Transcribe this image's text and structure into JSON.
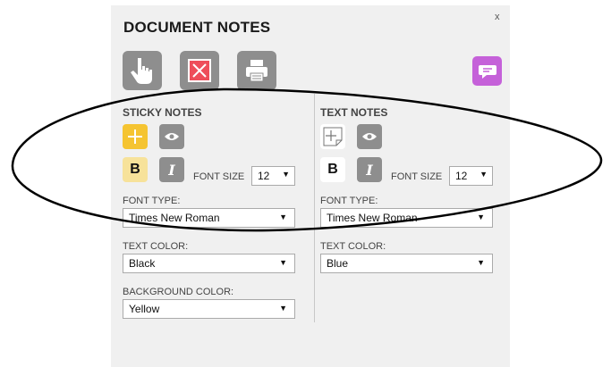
{
  "panel": {
    "title": "DOCUMENT NOTES",
    "close_label": "x"
  },
  "toolbar": {
    "select_icon": "hand-pointer-icon",
    "delete_icon": "delete-note-icon",
    "print_icon": "printer-icon",
    "comment_icon": "speech-bubble-icon"
  },
  "sticky": {
    "title": "STICKY NOTES",
    "bold_label": "B",
    "italic_label": "I",
    "font_size_label": "FONT SIZE",
    "font_size_value": "12",
    "font_type_label": "FONT TYPE:",
    "font_type_value": "Times New Roman",
    "text_color_label": "TEXT COLOR:",
    "text_color_value": "Black",
    "bg_color_label": "BACKGROUND COLOR:",
    "bg_color_value": "Yellow"
  },
  "text": {
    "title": "TEXT NOTES",
    "bold_label": "B",
    "italic_label": "I",
    "font_size_label": "FONT SIZE",
    "font_size_value": "12",
    "font_type_label": "FONT TYPE:",
    "font_type_value": "Times New Roman",
    "text_color_label": "TEXT COLOR:",
    "text_color_value": "Blue"
  },
  "colors": {
    "panel_bg": "#f0f0f0",
    "button_gray": "#8e8e8e",
    "sticky_yellow": "#f5c431",
    "delete_red": "#ee4e5a",
    "comment_purple": "#c561d9"
  },
  "select_arrow": "▼"
}
